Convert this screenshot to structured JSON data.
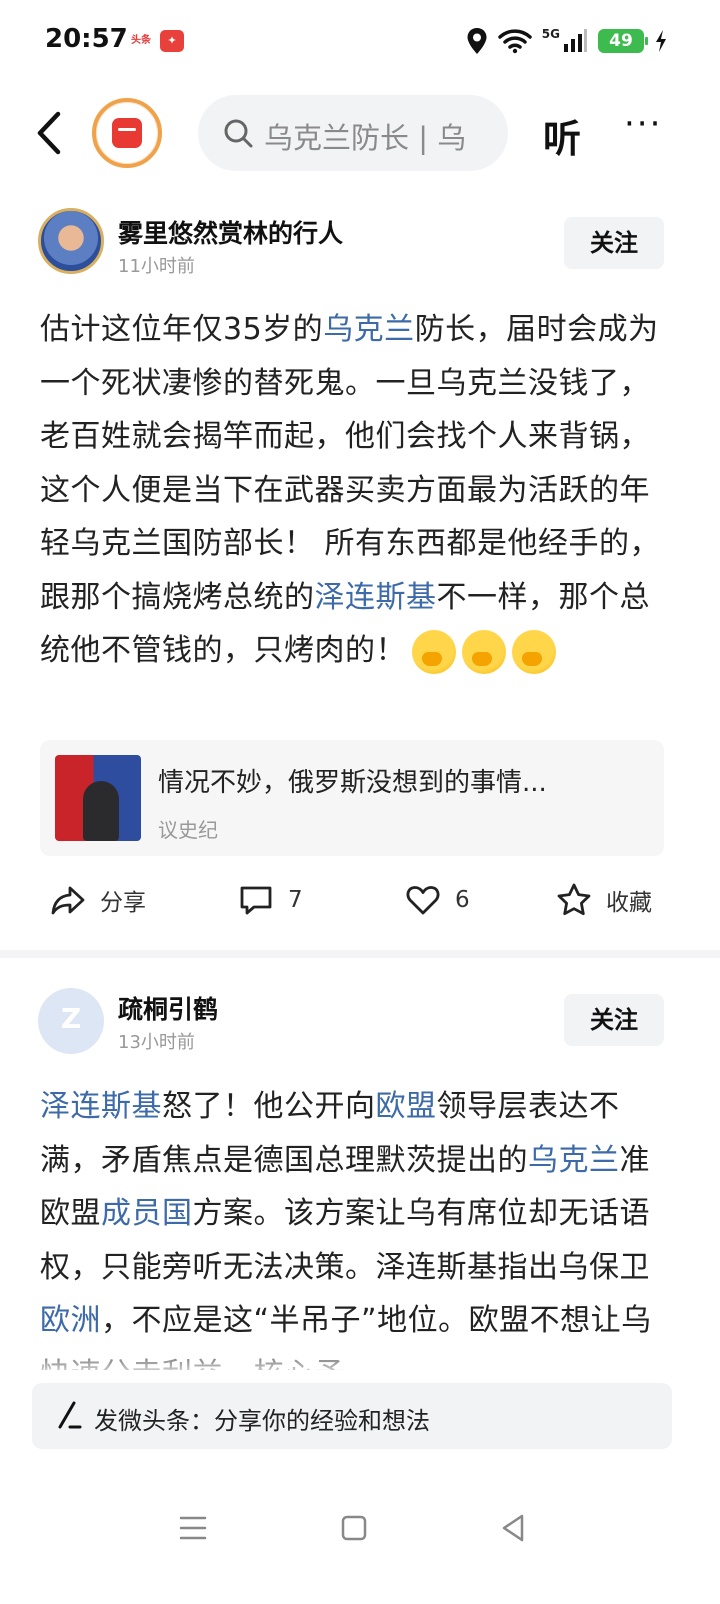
{
  "status_bar": {
    "time": "20:57",
    "notif_1": "头条",
    "notif_2": "✦",
    "network": "5G",
    "battery": "49"
  },
  "nav": {
    "search_placeholder": "乌克兰防长 | 乌",
    "listen": "听",
    "more": "···"
  },
  "posts": [
    {
      "author": "雾里悠然赏林的行人",
      "time": "11小时前",
      "follow": "关注",
      "body": {
        "p1": "估计这位年仅35岁的",
        "l1": "乌克兰",
        "p2": "防长，届时会成为一个死状凄惨的替死鬼。一旦乌克兰没钱了，老百姓就会揭竿而起，他们会找个人来背锅，这个人便是当下在武器买卖方面最为活跃的年轻乌克兰国防部长！ 所有东西都是他经手的，跟那个搞烧烤总统的",
        "l2": "泽连斯基",
        "p3": "不一样，那个总统他不管钱的，只烤肉的！"
      },
      "shared": {
        "title": "情况不妙，俄罗斯没想到的事情...",
        "source": "议史纪"
      },
      "actions": {
        "share": "分享",
        "comments": "7",
        "likes": "6",
        "favorite": "收藏"
      }
    },
    {
      "author": "疏桐引鹤",
      "time": "13小时前",
      "follow": "关注",
      "body": {
        "l1": "泽连斯基",
        "p1": "怒了！他公开向",
        "l2": "欧盟",
        "p2": "领导层表达不满，矛盾焦点是德国总理默茨提出的",
        "l3": "乌克兰",
        "p3": "准欧盟",
        "l4": "成员国",
        "p4": "方案。该方案让乌有席位却无话语权，只能旁听无法决策。泽连斯基指出乌保卫",
        "l5": "欧洲",
        "p5": "，不应是这“半吊子”地位。欧盟不想让乌快速分走利益，核心矛"
      }
    }
  ],
  "compose": {
    "label": "发微头条：分享你的经验和想法"
  }
}
